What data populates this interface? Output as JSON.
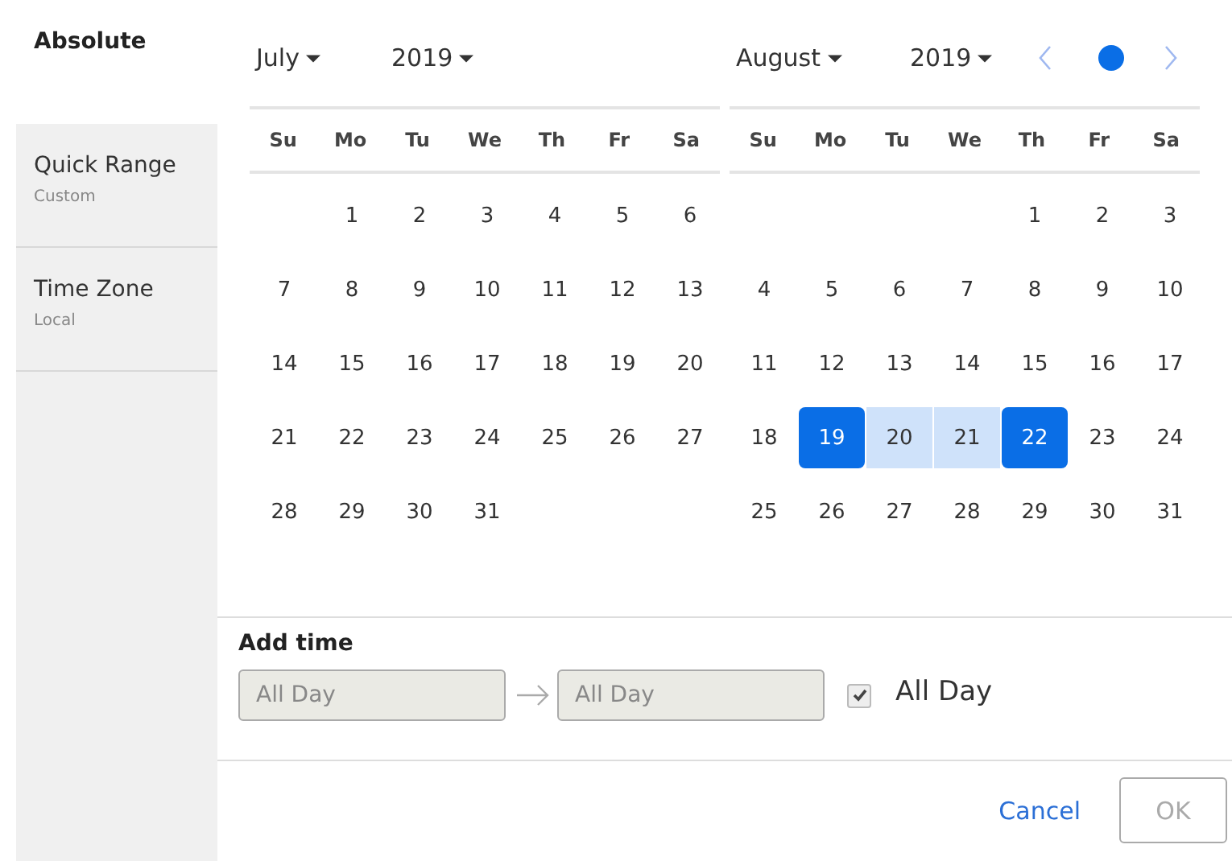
{
  "sidebar": {
    "items": [
      {
        "label": "Absolute",
        "selected": true
      },
      {
        "label": "Quick Range",
        "sub": "Custom",
        "selected": false
      },
      {
        "label": "Time Zone",
        "sub": "Local",
        "selected": false
      }
    ]
  },
  "calendars": [
    {
      "month": "July",
      "year": "2019",
      "weekdays": [
        "Su",
        "Mo",
        "Tu",
        "We",
        "Th",
        "Fr",
        "Sa"
      ],
      "weeks": [
        [
          {
            "kind": "blank"
          },
          {
            "kind": "day",
            "d": "1",
            "selected": false,
            "in_range": false
          },
          {
            "kind": "day",
            "d": "2",
            "selected": false,
            "in_range": false
          },
          {
            "kind": "day",
            "d": "3",
            "selected": false,
            "in_range": false
          },
          {
            "kind": "day",
            "d": "4",
            "selected": false,
            "in_range": false
          },
          {
            "kind": "day",
            "d": "5",
            "selected": false,
            "in_range": false
          },
          {
            "kind": "day",
            "d": "6",
            "selected": false,
            "in_range": false
          }
        ],
        [
          {
            "kind": "day",
            "d": "7",
            "selected": false,
            "in_range": false
          },
          {
            "kind": "day",
            "d": "8",
            "selected": false,
            "in_range": false
          },
          {
            "kind": "day",
            "d": "9",
            "selected": false,
            "in_range": false
          },
          {
            "kind": "day",
            "d": "10",
            "selected": false,
            "in_range": false
          },
          {
            "kind": "day",
            "d": "11",
            "selected": false,
            "in_range": false
          },
          {
            "kind": "day",
            "d": "12",
            "selected": false,
            "in_range": false
          },
          {
            "kind": "day",
            "d": "13",
            "selected": false,
            "in_range": false
          }
        ],
        [
          {
            "kind": "day",
            "d": "14",
            "selected": false,
            "in_range": false
          },
          {
            "kind": "day",
            "d": "15",
            "selected": false,
            "in_range": false
          },
          {
            "kind": "day",
            "d": "16",
            "selected": false,
            "in_range": false
          },
          {
            "kind": "day",
            "d": "17",
            "selected": false,
            "in_range": false
          },
          {
            "kind": "day",
            "d": "18",
            "selected": false,
            "in_range": false
          },
          {
            "kind": "day",
            "d": "19",
            "selected": false,
            "in_range": false
          },
          {
            "kind": "day",
            "d": "20",
            "selected": false,
            "in_range": false
          }
        ],
        [
          {
            "kind": "day",
            "d": "21",
            "selected": false,
            "in_range": false
          },
          {
            "kind": "day",
            "d": "22",
            "selected": false,
            "in_range": false
          },
          {
            "kind": "day",
            "d": "23",
            "selected": false,
            "in_range": false
          },
          {
            "kind": "day",
            "d": "24",
            "selected": false,
            "in_range": false
          },
          {
            "kind": "day",
            "d": "25",
            "selected": false,
            "in_range": false
          },
          {
            "kind": "day",
            "d": "26",
            "selected": false,
            "in_range": false
          },
          {
            "kind": "day",
            "d": "27",
            "selected": false,
            "in_range": false
          }
        ],
        [
          {
            "kind": "day",
            "d": "28",
            "selected": false,
            "in_range": false
          },
          {
            "kind": "day",
            "d": "29",
            "selected": false,
            "in_range": false
          },
          {
            "kind": "day",
            "d": "30",
            "selected": false,
            "in_range": false
          },
          {
            "kind": "day",
            "d": "31",
            "selected": false,
            "in_range": false
          },
          {
            "kind": "blank"
          },
          {
            "kind": "blank"
          },
          {
            "kind": "blank"
          }
        ]
      ]
    },
    {
      "month": "August",
      "year": "2019",
      "weekdays": [
        "Su",
        "Mo",
        "Tu",
        "We",
        "Th",
        "Fr",
        "Sa"
      ],
      "weeks": [
        [
          {
            "kind": "blank"
          },
          {
            "kind": "blank"
          },
          {
            "kind": "blank"
          },
          {
            "kind": "blank"
          },
          {
            "kind": "day",
            "d": "1",
            "selected": false,
            "in_range": false
          },
          {
            "kind": "day",
            "d": "2",
            "selected": false,
            "in_range": false
          },
          {
            "kind": "day",
            "d": "3",
            "selected": false,
            "in_range": false
          }
        ],
        [
          {
            "kind": "day",
            "d": "4",
            "selected": false,
            "in_range": false
          },
          {
            "kind": "day",
            "d": "5",
            "selected": false,
            "in_range": false
          },
          {
            "kind": "day",
            "d": "6",
            "selected": false,
            "in_range": false
          },
          {
            "kind": "day",
            "d": "7",
            "selected": false,
            "in_range": false
          },
          {
            "kind": "day",
            "d": "8",
            "selected": false,
            "in_range": false
          },
          {
            "kind": "day",
            "d": "9",
            "selected": false,
            "in_range": false
          },
          {
            "kind": "day",
            "d": "10",
            "selected": false,
            "in_range": false
          }
        ],
        [
          {
            "kind": "day",
            "d": "11",
            "selected": false,
            "in_range": false
          },
          {
            "kind": "day",
            "d": "12",
            "selected": false,
            "in_range": false
          },
          {
            "kind": "day",
            "d": "13",
            "selected": false,
            "in_range": false
          },
          {
            "kind": "day",
            "d": "14",
            "selected": false,
            "in_range": false
          },
          {
            "kind": "day",
            "d": "15",
            "selected": false,
            "in_range": false
          },
          {
            "kind": "day",
            "d": "16",
            "selected": false,
            "in_range": false
          },
          {
            "kind": "day",
            "d": "17",
            "selected": false,
            "in_range": false
          }
        ],
        [
          {
            "kind": "day",
            "d": "18",
            "selected": false,
            "in_range": false
          },
          {
            "kind": "day",
            "d": "19",
            "selected": true,
            "in_range": false
          },
          {
            "kind": "day",
            "d": "20",
            "selected": false,
            "in_range": true
          },
          {
            "kind": "day",
            "d": "21",
            "selected": false,
            "in_range": true
          },
          {
            "kind": "day",
            "d": "22",
            "selected": true,
            "in_range": false
          },
          {
            "kind": "day",
            "d": "23",
            "selected": false,
            "in_range": false
          },
          {
            "kind": "day",
            "d": "24",
            "selected": false,
            "in_range": false
          }
        ],
        [
          {
            "kind": "day",
            "d": "25",
            "selected": false,
            "in_range": false
          },
          {
            "kind": "day",
            "d": "26",
            "selected": false,
            "in_range": false
          },
          {
            "kind": "day",
            "d": "27",
            "selected": false,
            "in_range": false
          },
          {
            "kind": "day",
            "d": "28",
            "selected": false,
            "in_range": false
          },
          {
            "kind": "day",
            "d": "29",
            "selected": false,
            "in_range": false
          },
          {
            "kind": "day",
            "d": "30",
            "selected": false,
            "in_range": false
          },
          {
            "kind": "day",
            "d": "31",
            "selected": false,
            "in_range": false
          }
        ]
      ]
    }
  ],
  "time": {
    "title": "Add time",
    "from": {
      "value": "All Day",
      "disabled": true
    },
    "to": {
      "value": "All Day",
      "disabled": true
    },
    "all_day": {
      "label": "All Day",
      "checked": true
    }
  },
  "footer": {
    "cancel": "Cancel",
    "ok": {
      "label": "OK",
      "disabled": true
    }
  }
}
